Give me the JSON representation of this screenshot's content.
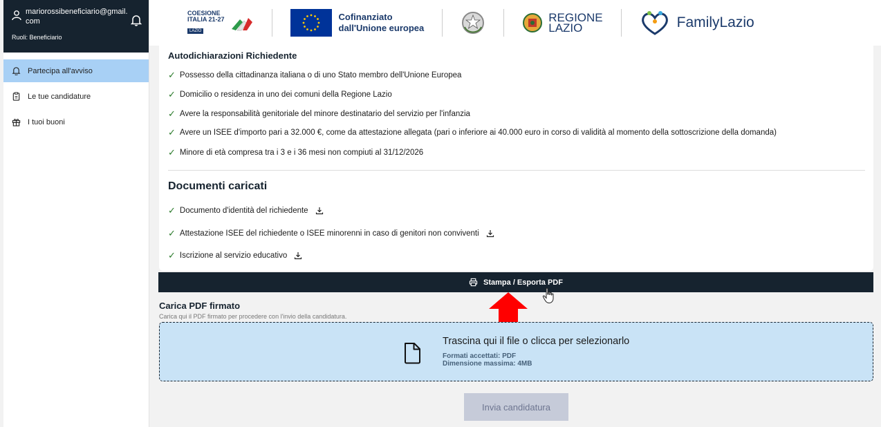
{
  "user": {
    "email": "mariorossibeneficiario@gmail.com",
    "roles": "Ruoli: Beneficiario"
  },
  "nav": [
    {
      "label": "Partecipa all'avviso",
      "icon": "bell-icon",
      "active": true
    },
    {
      "label": "Le tue candidature",
      "icon": "clipboard-icon",
      "active": false
    },
    {
      "label": "I tuoi buoni",
      "icon": "gift-icon",
      "active": false
    }
  ],
  "header": {
    "coesione": {
      "line1": "COESIONE",
      "line2": "ITALIA 21-27",
      "badge": "LAZIO"
    },
    "eu_line1": "Cofinanziato",
    "eu_line2": "dall'Unione europea",
    "regione_line1": "REGIONE",
    "regione_line2": "LAZIO",
    "family": "FamilyLazio"
  },
  "autodichiarazioni": {
    "title": "Autodichiarazioni Richiedente",
    "items": [
      "Possesso della cittadinanza italiana o di uno Stato membro dell'Unione Europea",
      "Domicilio o residenza in uno dei comuni della Regione Lazio",
      "Avere la responsabilità genitoriale del minore destinatario del servizio per l'infanzia",
      "Avere un ISEE d'importo pari a 32.000 €, come da attestazione allegata (pari o inferiore ai 40.000 euro in corso di validità al momento della sottoscrizione della domanda)",
      "Minore di età compresa tra i 3 e i 36 mesi non compiuti al 31/12/2026"
    ]
  },
  "documenti": {
    "title": "Documenti caricati",
    "items": [
      "Documento d'identità del richiedente",
      "Attestazione ISEE del richiedente o ISEE minorenni in caso di genitori non conviventi",
      "Iscrizione al servizio educativo"
    ]
  },
  "print_label": "Stampa / Esporta PDF",
  "upload": {
    "title": "Carica PDF firmato",
    "help": "Carica qui il PDF firmato per procedere con l'invio della candidatura.",
    "drop_main": "Trascina qui il file o clicca per selezionarlo",
    "formats": "Formati accettati: PDF",
    "max_size": "Dimensione massima: 4MB"
  },
  "submit_label": "Invia candidatura",
  "colors": {
    "dark": "#16232f",
    "nav_active": "#a8d0f5",
    "dropzone": "#c9e3f6",
    "arrow": "#ff0000"
  }
}
